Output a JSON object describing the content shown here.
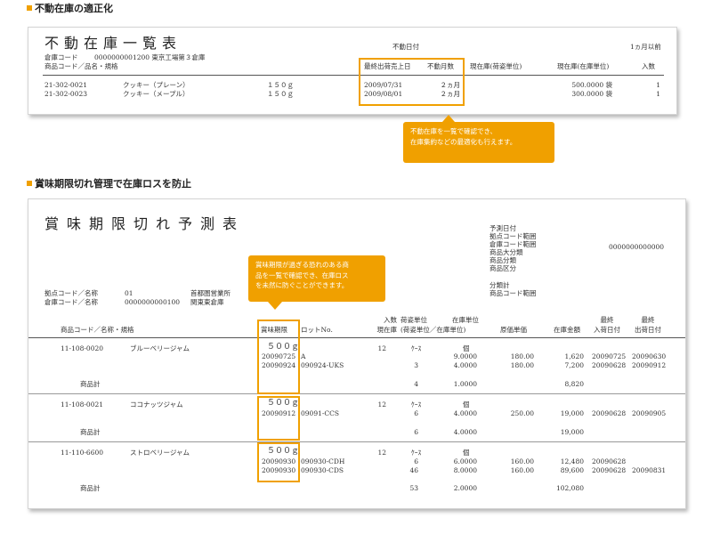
{
  "section1": {
    "heading": "不動在庫の適正化"
  },
  "section2": {
    "heading": "賞味期限切れ管理で在庫ロスを防止"
  },
  "doc1": {
    "title": "不動在庫一覧表",
    "warehouse_label": "倉庫コード",
    "warehouse_value": "0000000001200 東京工場第３倉庫",
    "product_label": "商品コード／品名・規格",
    "fudo_date_label": "不動日付",
    "month_filter": "1ヵ月以前",
    "col_last_ship": "最終出荷売上日",
    "col_months": "不動月数",
    "col_stock_pack": "現在庫(荷姿単位)",
    "col_stock_unit": "現在庫(在庫単位)",
    "col_count": "入数",
    "rows": [
      {
        "code": "21-302-0021",
        "name": "クッキー（プレーン）",
        "spec": "１５０ｇ",
        "date": "2009/07/31",
        "months": "２ヵ月",
        "stock": "500.0000 袋",
        "count": "1"
      },
      {
        "code": "21-302-0023",
        "name": "クッキー（メープル）",
        "spec": "１５０ｇ",
        "date": "2009/08/01",
        "months": "２ヵ月",
        "stock": "300.0000 袋",
        "count": "1"
      }
    ]
  },
  "callout1": {
    "line1": "不動在庫を一覧で確認でき、",
    "line2": "在庫集約などの最適化も行えます。"
  },
  "doc2": {
    "title": "賞味期限切れ予測表",
    "cond_labels": [
      "予測日付",
      "拠点コード範囲",
      "倉庫コード範囲",
      "商品大分類",
      "商品分類",
      "商品区分",
      "分類計",
      "商品コード範囲"
    ],
    "cond_value": "0000000000000",
    "base_label": "拠点コード／名称",
    "base_code": "01",
    "base_name": "首都圏営業所",
    "wh_label": "倉庫コード／名称",
    "wh_code": "0000000000100",
    "wh_name": "関東東倉庫",
    "h_product": "商品コード／名称・規格",
    "h_expiry": "賞味期限",
    "h_lot": "ロットNo.",
    "h_count1": "入数",
    "h_count2": "現在庫",
    "h_pack1": "荷姿単位",
    "h_pack2": "(荷姿単位／在庫単位)",
    "h_unit1": "在庫単位",
    "h_cost": "原価単価",
    "h_amount": "在庫金額",
    "h_last_in1": "最終",
    "h_last_in2": "入荷日付",
    "h_last_out1": "最終",
    "h_last_out2": "出荷日付",
    "subtotal_label": "商品計",
    "groups": [
      {
        "code": "11-108-0020",
        "name": "ブルーベリージャム",
        "spec": "５００ｇ",
        "count": "12",
        "unit_case": "ｹｰｽ",
        "unit_piece": "個",
        "lines": [
          {
            "expiry": "20090725",
            "lot": "A",
            "qty_case": "",
            "qty_piece": "9.0000",
            "cost": "180.00",
            "amount": "1,620",
            "last_in": "20090725",
            "last_out": "20090630"
          },
          {
            "expiry": "20090924",
            "lot": "090924-UKS",
            "qty_case": "3",
            "qty_piece": "4.0000",
            "cost": "180.00",
            "amount": "7,200",
            "last_in": "20090628",
            "last_out": "20090912"
          }
        ],
        "sub_case": "4",
        "sub_piece": "1.0000",
        "sub_amount": "8,820"
      },
      {
        "code": "11-108-0021",
        "name": "ココナッツジャム",
        "spec": "５００ｇ",
        "count": "12",
        "unit_case": "ｹｰｽ",
        "unit_piece": "個",
        "lines": [
          {
            "expiry": "20090912",
            "lot": "09091-CCS",
            "qty_case": "6",
            "qty_piece": "4.0000",
            "cost": "250.00",
            "amount": "19,000",
            "last_in": "20090628",
            "last_out": "20090905"
          }
        ],
        "sub_case": "6",
        "sub_piece": "4.0000",
        "sub_amount": "19,000"
      },
      {
        "code": "11-110-6600",
        "name": "ストロベリージャム",
        "spec": "５００ｇ",
        "count": "12",
        "unit_case": "ｹｰｽ",
        "unit_piece": "個",
        "lines": [
          {
            "expiry": "20090930",
            "lot": "090930-CDH",
            "qty_case": "6",
            "qty_piece": "6.0000",
            "cost": "160.00",
            "amount": "12,480",
            "last_in": "20090628",
            "last_out": ""
          },
          {
            "expiry": "20090930",
            "lot": "090930-CDS",
            "qty_case": "46",
            "qty_piece": "8.0000",
            "cost": "160.00",
            "amount": "89,600",
            "last_in": "20090628",
            "last_out": "20090831"
          }
        ],
        "sub_case": "53",
        "sub_piece": "2.0000",
        "sub_amount": "102,080"
      }
    ]
  },
  "callout2": {
    "line1": "賞味期限が過ぎる恐れのある商",
    "line2": "品を一覧で確認でき、在庫ロス",
    "line3": "を未然に防ぐことができます。"
  },
  "colors": {
    "accent": "#f0a000"
  }
}
